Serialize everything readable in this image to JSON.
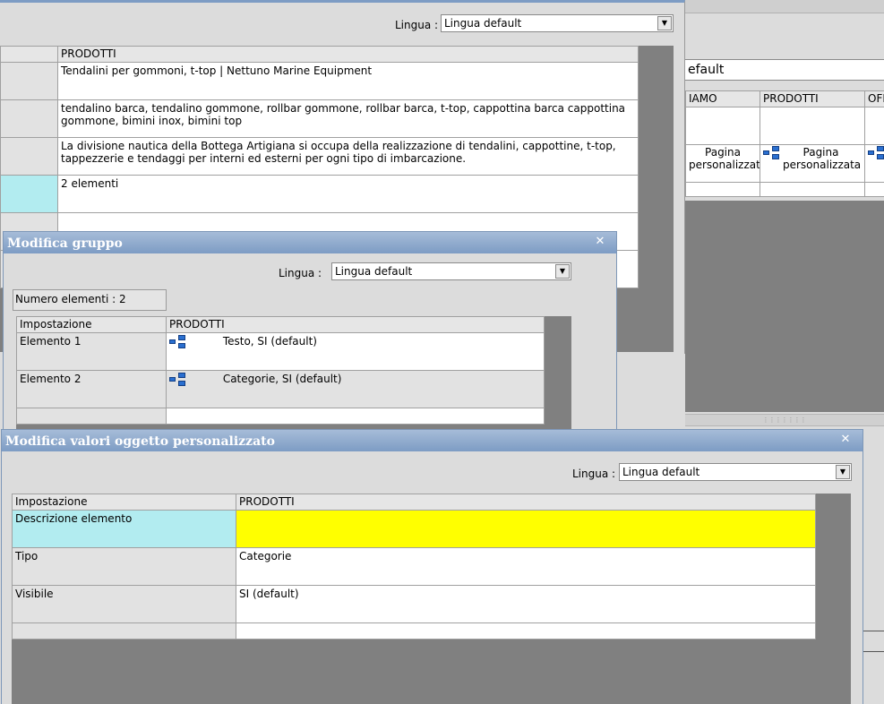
{
  "lingua_label": "Lingua :",
  "lingua_value": "Lingua default",
  "back_window": {
    "column_header": "PRODOTTI",
    "rows": [
      "Tendalini per gommoni, t-top | Nettuno Marine Equipment",
      "tendalino barca, tendalino gommone, rollbar gommone, rollbar barca, t-top, cappottina barca cappottina gommone, bimini inox, bimini top",
      "La divisione nautica della Bottega Artigiana si occupa della realizzazione di tendalini, cappottine, t-top, tappezzerie e tendaggi per interni ed esterni per ogni tipo di imbarcazione.",
      "2 elementi"
    ]
  },
  "right_window": {
    "lingua_partial": "efault",
    "columns": [
      "IAMO",
      "PRODOTTI",
      "OFI"
    ],
    "page_cell_a": "Pagina\npersonalizzata",
    "page_cell_b": "Pagina\npersonalizzata"
  },
  "modifica_gruppo": {
    "title": "Modifica gruppo",
    "count_label": "Numero elementi : 2",
    "columns": [
      "Impostazione",
      "PRODOTTI"
    ],
    "rows": [
      {
        "label": "Elemento 1",
        "value": "Testo, SI (default)"
      },
      {
        "label": "Elemento 2",
        "value": "Categorie, SI (default)"
      }
    ]
  },
  "modifica_valori": {
    "title": "Modifica valori oggetto personalizzato",
    "columns": [
      "Impostazione",
      "PRODOTTI"
    ],
    "rows": [
      {
        "label": "Descrizione elemento",
        "value": ""
      },
      {
        "label": "Tipo",
        "value": "Categorie"
      },
      {
        "label": "Visibile",
        "value": "SI (default)"
      }
    ]
  },
  "colors": {
    "selected_label": "#b2ecf0",
    "edit_cell": "#ffff00",
    "title_gradient_top": "#a6bcd8",
    "title_gradient_bottom": "#7d9cc4"
  }
}
